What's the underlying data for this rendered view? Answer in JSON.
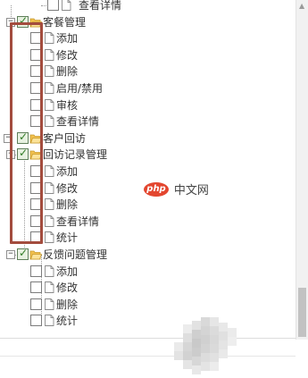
{
  "tree": [
    {
      "label": "查看详情",
      "level": 3,
      "checked": false
    },
    {
      "label": "客餐管理",
      "level": 1,
      "checked": true,
      "toggle": "⊟"
    },
    {
      "label": "添加",
      "level": 2,
      "checked": false
    },
    {
      "label": "修改",
      "level": 2,
      "checked": false
    },
    {
      "label": "删除",
      "level": 2,
      "checked": false
    },
    {
      "label": "启用/禁用",
      "level": 2,
      "checked": false
    },
    {
      "label": "审核",
      "level": 2,
      "checked": false
    },
    {
      "label": "查看详情",
      "level": 2,
      "checked": false
    },
    {
      "label": "客户回访",
      "level": 0,
      "checked": true,
      "toggle": "⊟"
    },
    {
      "label": "回访记录管理",
      "level": 1,
      "checked": true,
      "toggle": "⊟"
    },
    {
      "label": "添加",
      "level": 2,
      "checked": false
    },
    {
      "label": "修改",
      "level": 2,
      "checked": false
    },
    {
      "label": "删除",
      "level": 2,
      "checked": false
    },
    {
      "label": "查看详情",
      "level": 2,
      "checked": false
    },
    {
      "label": "统计",
      "level": 2,
      "checked": false
    },
    {
      "label": "反馈问题管理",
      "level": 1,
      "checked": true,
      "toggle": "⊟"
    },
    {
      "label": "添加",
      "level": 2,
      "checked": false
    },
    {
      "label": "修改",
      "level": 2,
      "checked": false
    },
    {
      "label": "删除",
      "level": 2,
      "checked": false
    },
    {
      "label": "统计",
      "level": 2,
      "checked": false
    }
  ],
  "watermark": {
    "logo": "php",
    "text": "中文网"
  },
  "colors": {
    "highlight": "#a34c3e",
    "check": "#2f7a24",
    "folder": "#f2c14e"
  }
}
